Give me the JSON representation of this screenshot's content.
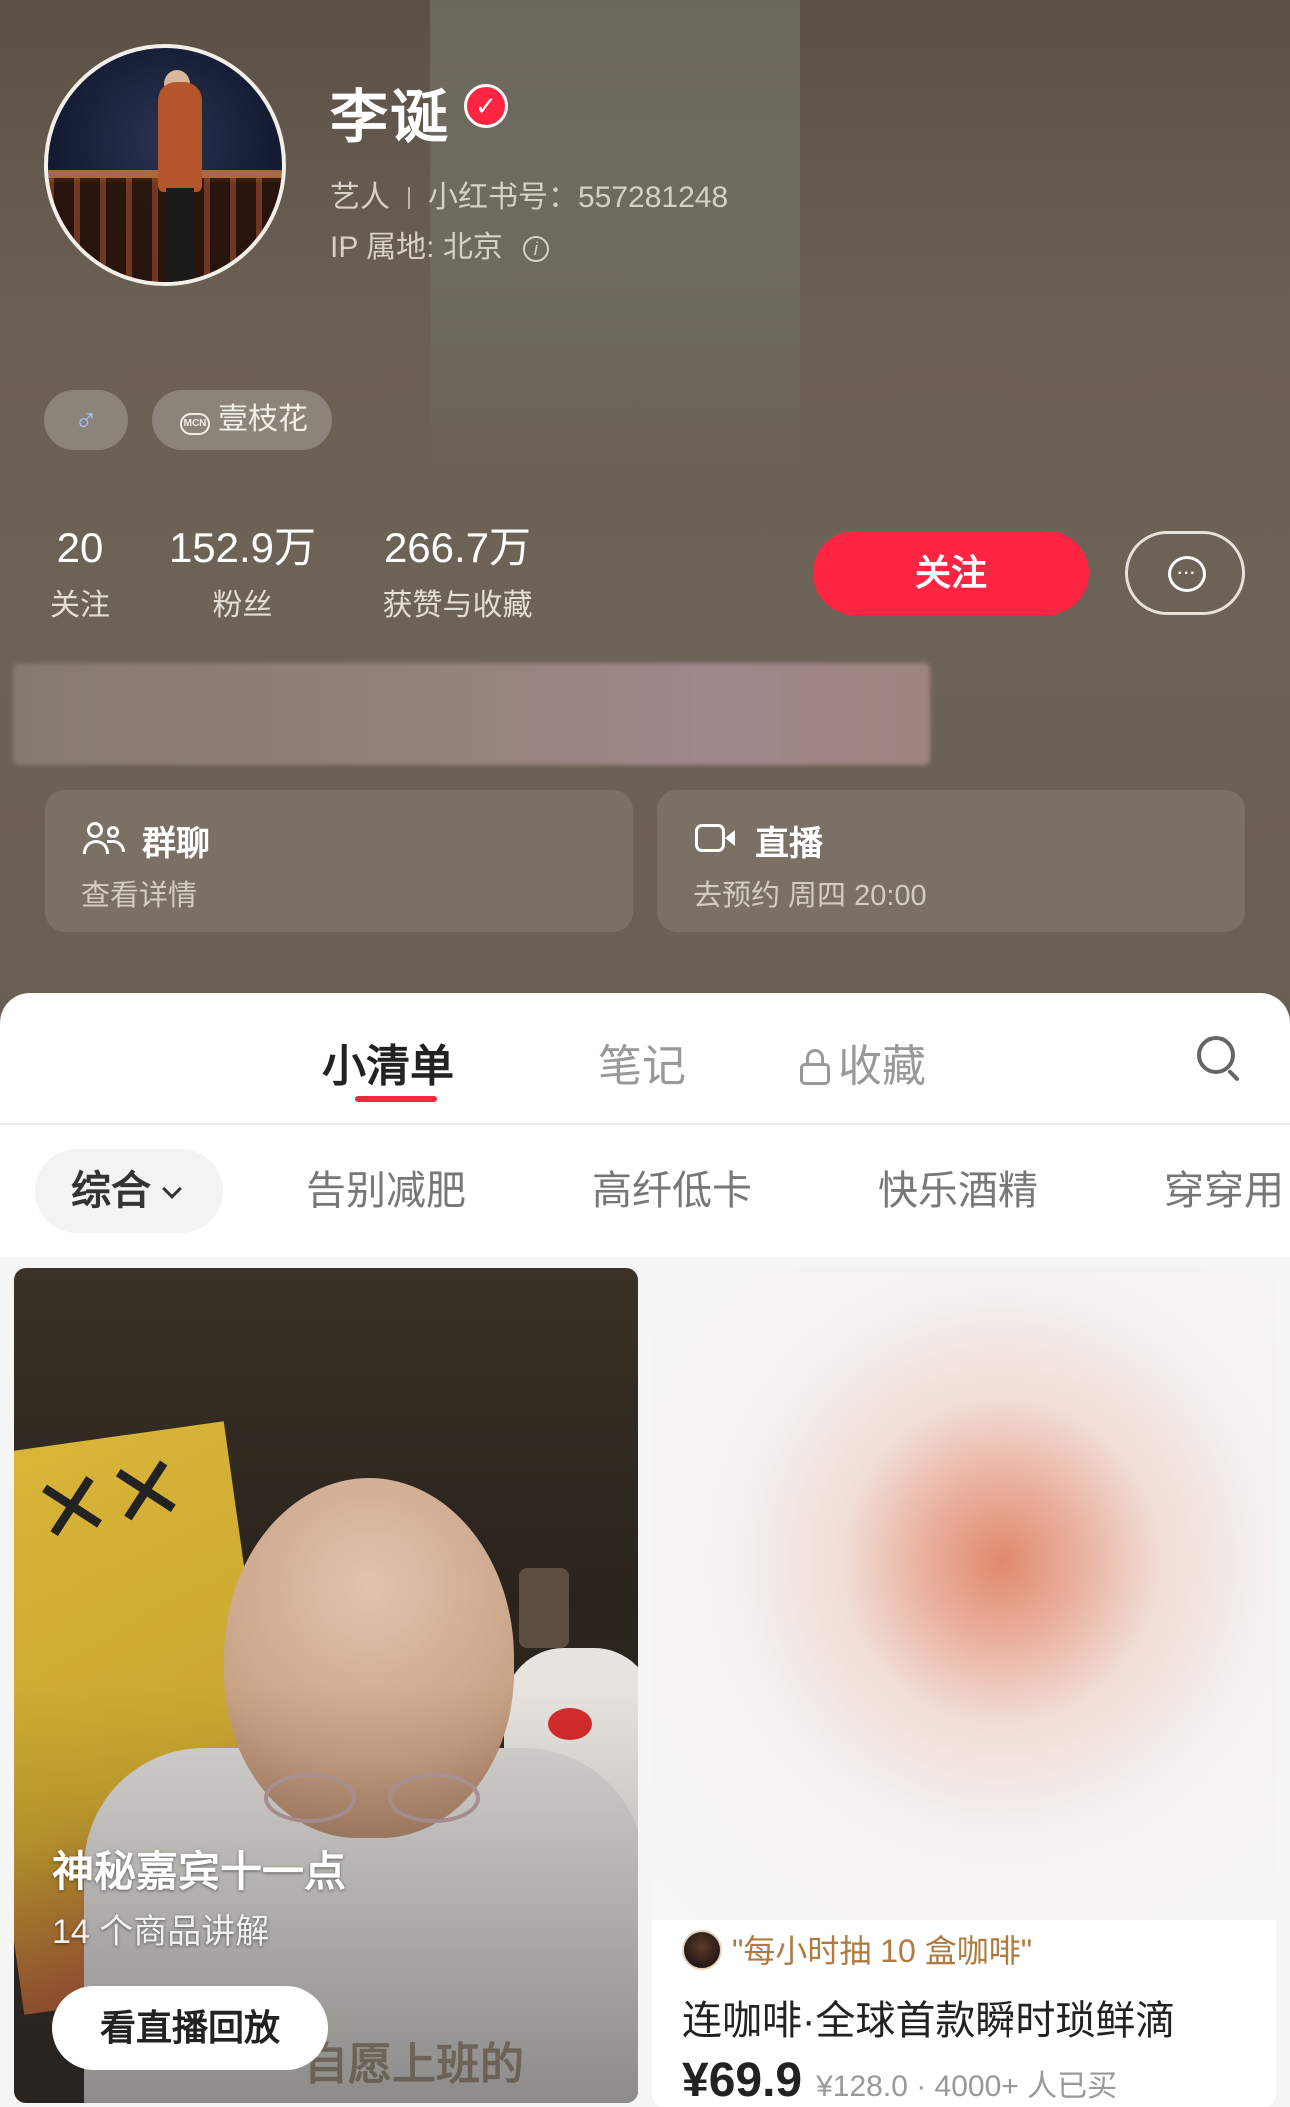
{
  "profile": {
    "name": "李诞",
    "verified_mark": "✓",
    "role": "艺人",
    "redbook_id_label": "小红书号：",
    "redbook_id": "557281248",
    "ip_label": "IP 属地: ",
    "ip_location": "北京",
    "info_glyph": "i",
    "gender_glyph": "♂",
    "mcn_icon_text": "MCN",
    "mcn_name": "壹枝花"
  },
  "stats": [
    {
      "value": "20",
      "label": "关注"
    },
    {
      "value": "152.9万",
      "label": "粉丝"
    },
    {
      "value": "266.7万",
      "label": "获赞与收藏"
    }
  ],
  "actions": {
    "follow_label": "关注",
    "message_dots": "···"
  },
  "cards": {
    "group": {
      "title": "群聊",
      "subtitle": "查看详情"
    },
    "live": {
      "title": "直播",
      "subtitle": "去预约 周四 20:00"
    }
  },
  "tabs": {
    "list": "小清单",
    "notes": "笔记",
    "collect": "收藏"
  },
  "filters": {
    "active": "综合",
    "items": [
      "告别减肥",
      "高纤低卡",
      "快乐酒精",
      "穿穿用"
    ]
  },
  "items": [
    {
      "title": "神秘嘉宾十一点",
      "subtitle": "14 个商品讲解",
      "button": "看直播回放",
      "background_text": "自愿上班的"
    },
    {
      "source": "\"每小时抽 10 盒咖啡\"",
      "title": "连咖啡·全球首款瞬时琐鲜滴",
      "price": "¥69.9",
      "extra": "¥128.0 · 4000+ 人已买"
    }
  ],
  "colors": {
    "brand_red": "#ff2442",
    "header_bg": "#6b6054",
    "source_gold": "#b07a3e"
  }
}
